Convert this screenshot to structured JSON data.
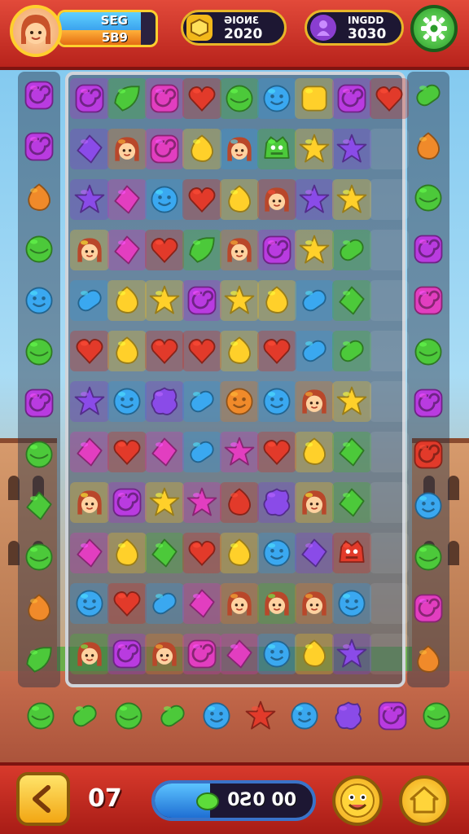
{
  "player": {
    "xp_label": "SEG",
    "xp_value": "5B9",
    "xp_progress": 0.85
  },
  "hud": {
    "gold": {
      "label": "ƏIOИƐ",
      "value": "2020"
    },
    "gems": {
      "label": "INGDD",
      "value": "3030"
    }
  },
  "moves": {
    "value": "07"
  },
  "score": {
    "value": "0Ƨ0 00",
    "progress": 0.35
  },
  "colors": {
    "purple": "#b93be0",
    "green": "#4cc93a",
    "red": "#e23a2a",
    "blue": "#3aa8f0",
    "yellow": "#ffd02a",
    "orange": "#f08a2a",
    "violet": "#8a4be8",
    "pink": "#e23ec0"
  },
  "board": {
    "rows": [
      [
        [
          "purple",
          "swirl"
        ],
        [
          "green",
          "leaf"
        ],
        [
          "pink",
          "swirl"
        ],
        [
          "red",
          "heart"
        ],
        [
          "green",
          "round"
        ],
        [
          "blue",
          "smile"
        ],
        [
          "yellow",
          "square"
        ],
        [
          "purple",
          "swirl"
        ],
        [
          "red",
          "heart"
        ]
      ],
      [
        [
          "violet",
          "diamond"
        ],
        [
          "orange",
          "face"
        ],
        [
          "pink",
          "swirl"
        ],
        [
          "yellow",
          "drop"
        ],
        [
          "blue",
          "face"
        ],
        [
          "green",
          "monster"
        ],
        [
          "yellow",
          "star"
        ],
        [
          "violet",
          "star"
        ],
        [
          "",
          "none"
        ]
      ],
      [
        [
          "violet",
          "star"
        ],
        [
          "pink",
          "diamond"
        ],
        [
          "blue",
          "smile"
        ],
        [
          "red",
          "heart"
        ],
        [
          "yellow",
          "drop"
        ],
        [
          "red",
          "face"
        ],
        [
          "violet",
          "star"
        ],
        [
          "yellow",
          "star"
        ],
        [
          "",
          "none"
        ]
      ],
      [
        [
          "yellow",
          "face"
        ],
        [
          "pink",
          "diamond"
        ],
        [
          "red",
          "heart"
        ],
        [
          "green",
          "leaf"
        ],
        [
          "orange",
          "face"
        ],
        [
          "purple",
          "swirl"
        ],
        [
          "yellow",
          "star"
        ],
        [
          "green",
          "pill"
        ],
        [
          "",
          "none"
        ]
      ],
      [
        [
          "blue",
          "pill"
        ],
        [
          "yellow",
          "drop"
        ],
        [
          "yellow",
          "star"
        ],
        [
          "purple",
          "swirl"
        ],
        [
          "yellow",
          "star"
        ],
        [
          "yellow",
          "drop"
        ],
        [
          "blue",
          "pill"
        ],
        [
          "green",
          "diamond"
        ],
        [
          "",
          "none"
        ]
      ],
      [
        [
          "red",
          "heart"
        ],
        [
          "yellow",
          "drop"
        ],
        [
          "red",
          "heart"
        ],
        [
          "red",
          "heart"
        ],
        [
          "yellow",
          "drop"
        ],
        [
          "red",
          "heart"
        ],
        [
          "blue",
          "pill"
        ],
        [
          "green",
          "pill"
        ],
        [
          "",
          "none"
        ]
      ],
      [
        [
          "violet",
          "star"
        ],
        [
          "blue",
          "smile"
        ],
        [
          "violet",
          "blob"
        ],
        [
          "blue",
          "pill"
        ],
        [
          "orange",
          "smile"
        ],
        [
          "blue",
          "smile"
        ],
        [
          "orange",
          "face"
        ],
        [
          "yellow",
          "star"
        ],
        [
          "",
          "none"
        ]
      ],
      [
        [
          "pink",
          "diamond"
        ],
        [
          "red",
          "heart"
        ],
        [
          "pink",
          "diamond"
        ],
        [
          "blue",
          "pill"
        ],
        [
          "pink",
          "star"
        ],
        [
          "red",
          "heart"
        ],
        [
          "yellow",
          "drop"
        ],
        [
          "green",
          "diamond"
        ],
        [
          "",
          "none"
        ]
      ],
      [
        [
          "yellow",
          "face"
        ],
        [
          "purple",
          "swirl"
        ],
        [
          "yellow",
          "star"
        ],
        [
          "pink",
          "star"
        ],
        [
          "red",
          "drop"
        ],
        [
          "violet",
          "blob"
        ],
        [
          "yellow",
          "face"
        ],
        [
          "green",
          "diamond"
        ],
        [
          "",
          "none"
        ]
      ],
      [
        [
          "pink",
          "diamond"
        ],
        [
          "yellow",
          "drop"
        ],
        [
          "green",
          "diamond"
        ],
        [
          "red",
          "heart"
        ],
        [
          "yellow",
          "drop"
        ],
        [
          "blue",
          "smile"
        ],
        [
          "violet",
          "diamond"
        ],
        [
          "red",
          "monster"
        ],
        [
          "",
          "none"
        ]
      ],
      [
        [
          "blue",
          "smile"
        ],
        [
          "red",
          "heart"
        ],
        [
          "blue",
          "pill"
        ],
        [
          "pink",
          "diamond"
        ],
        [
          "orange",
          "face"
        ],
        [
          "green",
          "face"
        ],
        [
          "orange",
          "face"
        ],
        [
          "blue",
          "smile"
        ],
        [
          "",
          "none"
        ]
      ],
      [
        [
          "green",
          "face"
        ],
        [
          "purple",
          "swirl"
        ],
        [
          "orange",
          "face"
        ],
        [
          "pink",
          "swirl"
        ],
        [
          "pink",
          "diamond"
        ],
        [
          "blue",
          "smile"
        ],
        [
          "yellow",
          "drop"
        ],
        [
          "violet",
          "star"
        ],
        [
          "",
          "none"
        ]
      ]
    ],
    "left_column": [
      [
        "purple",
        "swirl"
      ],
      [
        "purple",
        "swirl"
      ],
      [
        "orange",
        "drop"
      ],
      [
        "green",
        "round"
      ],
      [
        "blue",
        "smile"
      ],
      [
        "green",
        "round"
      ],
      [
        "purple",
        "swirl"
      ],
      [
        "green",
        "round"
      ],
      [
        "green",
        "diamond"
      ],
      [
        "green",
        "round"
      ],
      [
        "orange",
        "drop"
      ],
      [
        "green",
        "leaf"
      ]
    ],
    "right_column": [
      [
        "green",
        "pill"
      ],
      [
        "orange",
        "drop"
      ],
      [
        "green",
        "round"
      ],
      [
        "purple",
        "swirl"
      ],
      [
        "pink",
        "swirl"
      ],
      [
        "green",
        "round"
      ],
      [
        "purple",
        "swirl"
      ],
      [
        "red",
        "swirl"
      ],
      [
        "blue",
        "smile"
      ],
      [
        "green",
        "round"
      ],
      [
        "pink",
        "swirl"
      ],
      [
        "orange",
        "drop"
      ]
    ],
    "tray": [
      [
        "green",
        "round"
      ],
      [
        "green",
        "pill"
      ],
      [
        "green",
        "round"
      ],
      [
        "green",
        "pill"
      ],
      [
        "blue",
        "smile"
      ],
      [
        "red",
        "star"
      ],
      [
        "blue",
        "smile"
      ],
      [
        "violet",
        "blob"
      ],
      [
        "purple",
        "swirl"
      ],
      [
        "green",
        "round"
      ]
    ]
  }
}
